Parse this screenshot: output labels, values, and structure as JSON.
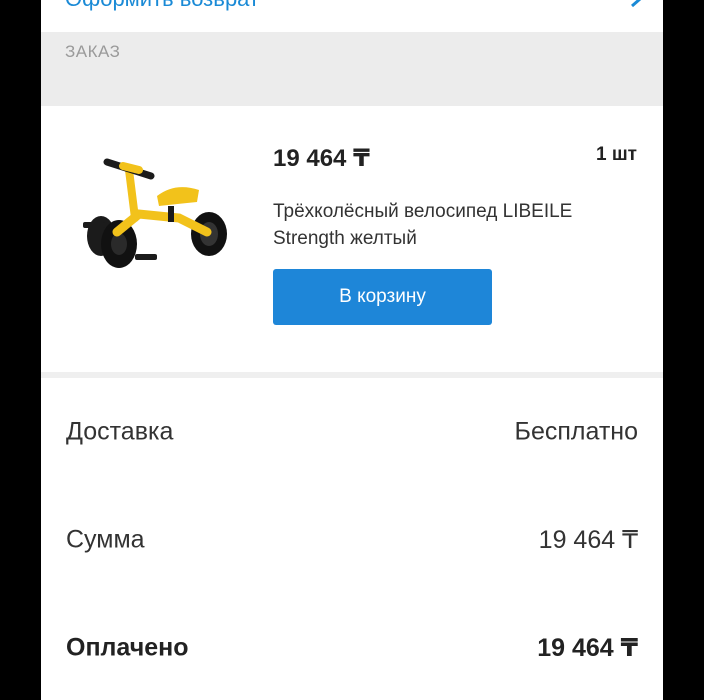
{
  "header": {
    "link_label": "Оформить возврат",
    "chevron_icon": "chevron-right-icon"
  },
  "order_section": {
    "title": "ЗАКАЗ"
  },
  "product": {
    "price": "19 464 ₸",
    "quantity": "1 шт",
    "name": "Трёхколёсный велосипед LIBEILE Strength желтый",
    "image_icon": "tricycle-image",
    "cart_button_label": "В корзину"
  },
  "summary": {
    "delivery_label": "Доставка",
    "delivery_value": "Бесплатно",
    "sum_label": "Сумма",
    "sum_value": "19 464 ₸",
    "paid_label": "Оплачено",
    "paid_value": "19 464 ₸"
  },
  "colors": {
    "accent": "#1e86d8",
    "product_yellow": "#f2c21b"
  }
}
